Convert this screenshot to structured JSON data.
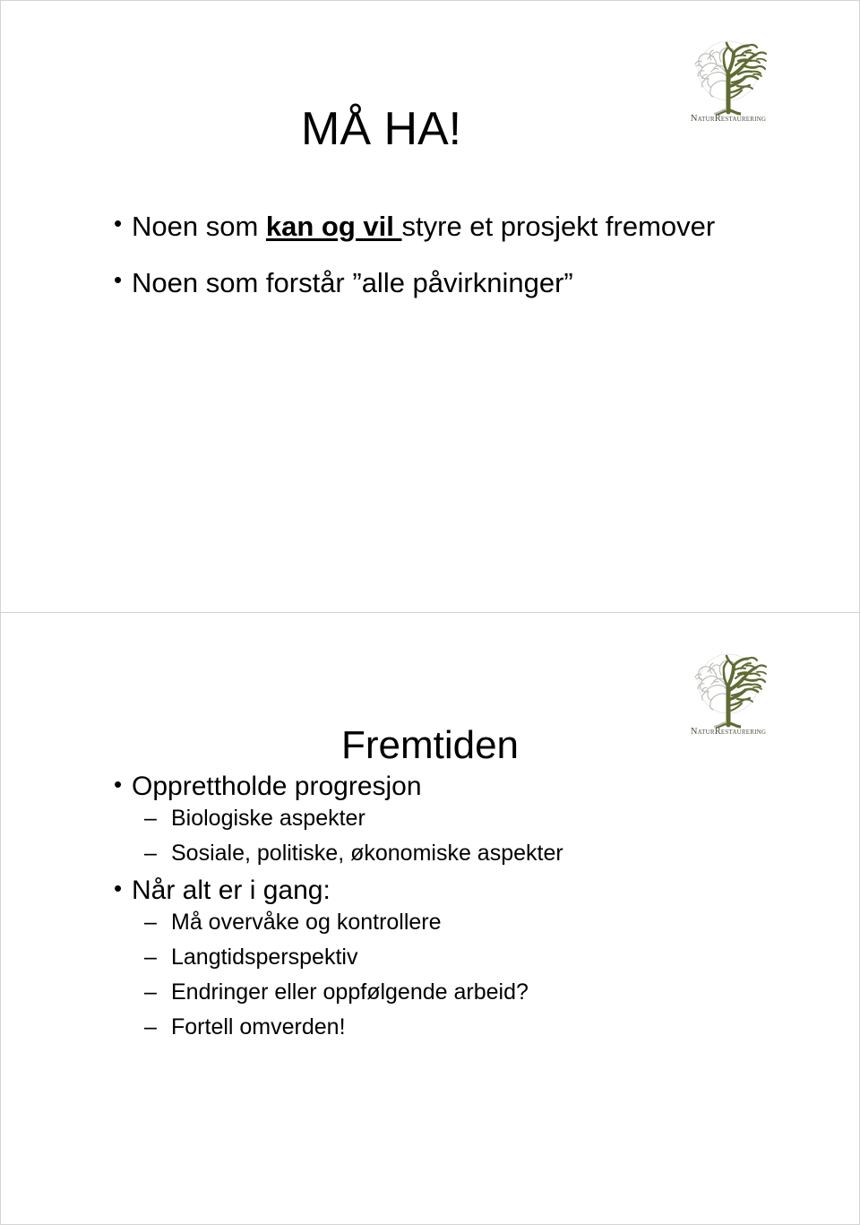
{
  "document": {
    "kind": "presentation-handout",
    "slide_count": 2
  },
  "logo": {
    "name": "naturrestaurering-logo",
    "wordmark": "NaturRestaurering",
    "tree_green": "#5f6b33",
    "tree_outline": "#b9bbb4",
    "wordmark_color": "#4c4c3e"
  },
  "slides": [
    {
      "id": "slide-ma-ha",
      "title": "MÅ HA!",
      "bullets": [
        {
          "level": 1,
          "segments": [
            {
              "text": "Noen som ",
              "emphasis": false
            },
            {
              "text": "kan og vil ",
              "emphasis": true
            },
            {
              "text": "styre et prosjekt fremover",
              "emphasis": false
            }
          ]
        },
        {
          "level": 1,
          "segments": [
            {
              "text": "Noen som forstår ”alle påvirkninger”",
              "emphasis": false
            }
          ]
        }
      ]
    },
    {
      "id": "slide-fremtiden",
      "title": "Fremtiden",
      "bullets": [
        {
          "level": 1,
          "segments": [
            {
              "text": "Opprettholde progresjon",
              "emphasis": false
            }
          ]
        },
        {
          "level": 2,
          "segments": [
            {
              "text": "Biologiske aspekter",
              "emphasis": false
            }
          ]
        },
        {
          "level": 2,
          "segments": [
            {
              "text": "Sosiale, politiske, økonomiske aspekter",
              "emphasis": false
            }
          ]
        },
        {
          "level": 1,
          "segments": [
            {
              "text": "Når alt er i gang:",
              "emphasis": false
            }
          ]
        },
        {
          "level": 2,
          "segments": [
            {
              "text": "Må overvåke og kontrollere",
              "emphasis": false
            }
          ]
        },
        {
          "level": 2,
          "segments": [
            {
              "text": "Langtidsperspektiv",
              "emphasis": false
            }
          ]
        },
        {
          "level": 2,
          "segments": [
            {
              "text": "Endringer eller oppfølgende arbeid?",
              "emphasis": false
            }
          ]
        },
        {
          "level": 2,
          "segments": [
            {
              "text": "Fortell omverden!",
              "emphasis": false
            }
          ]
        }
      ]
    }
  ]
}
